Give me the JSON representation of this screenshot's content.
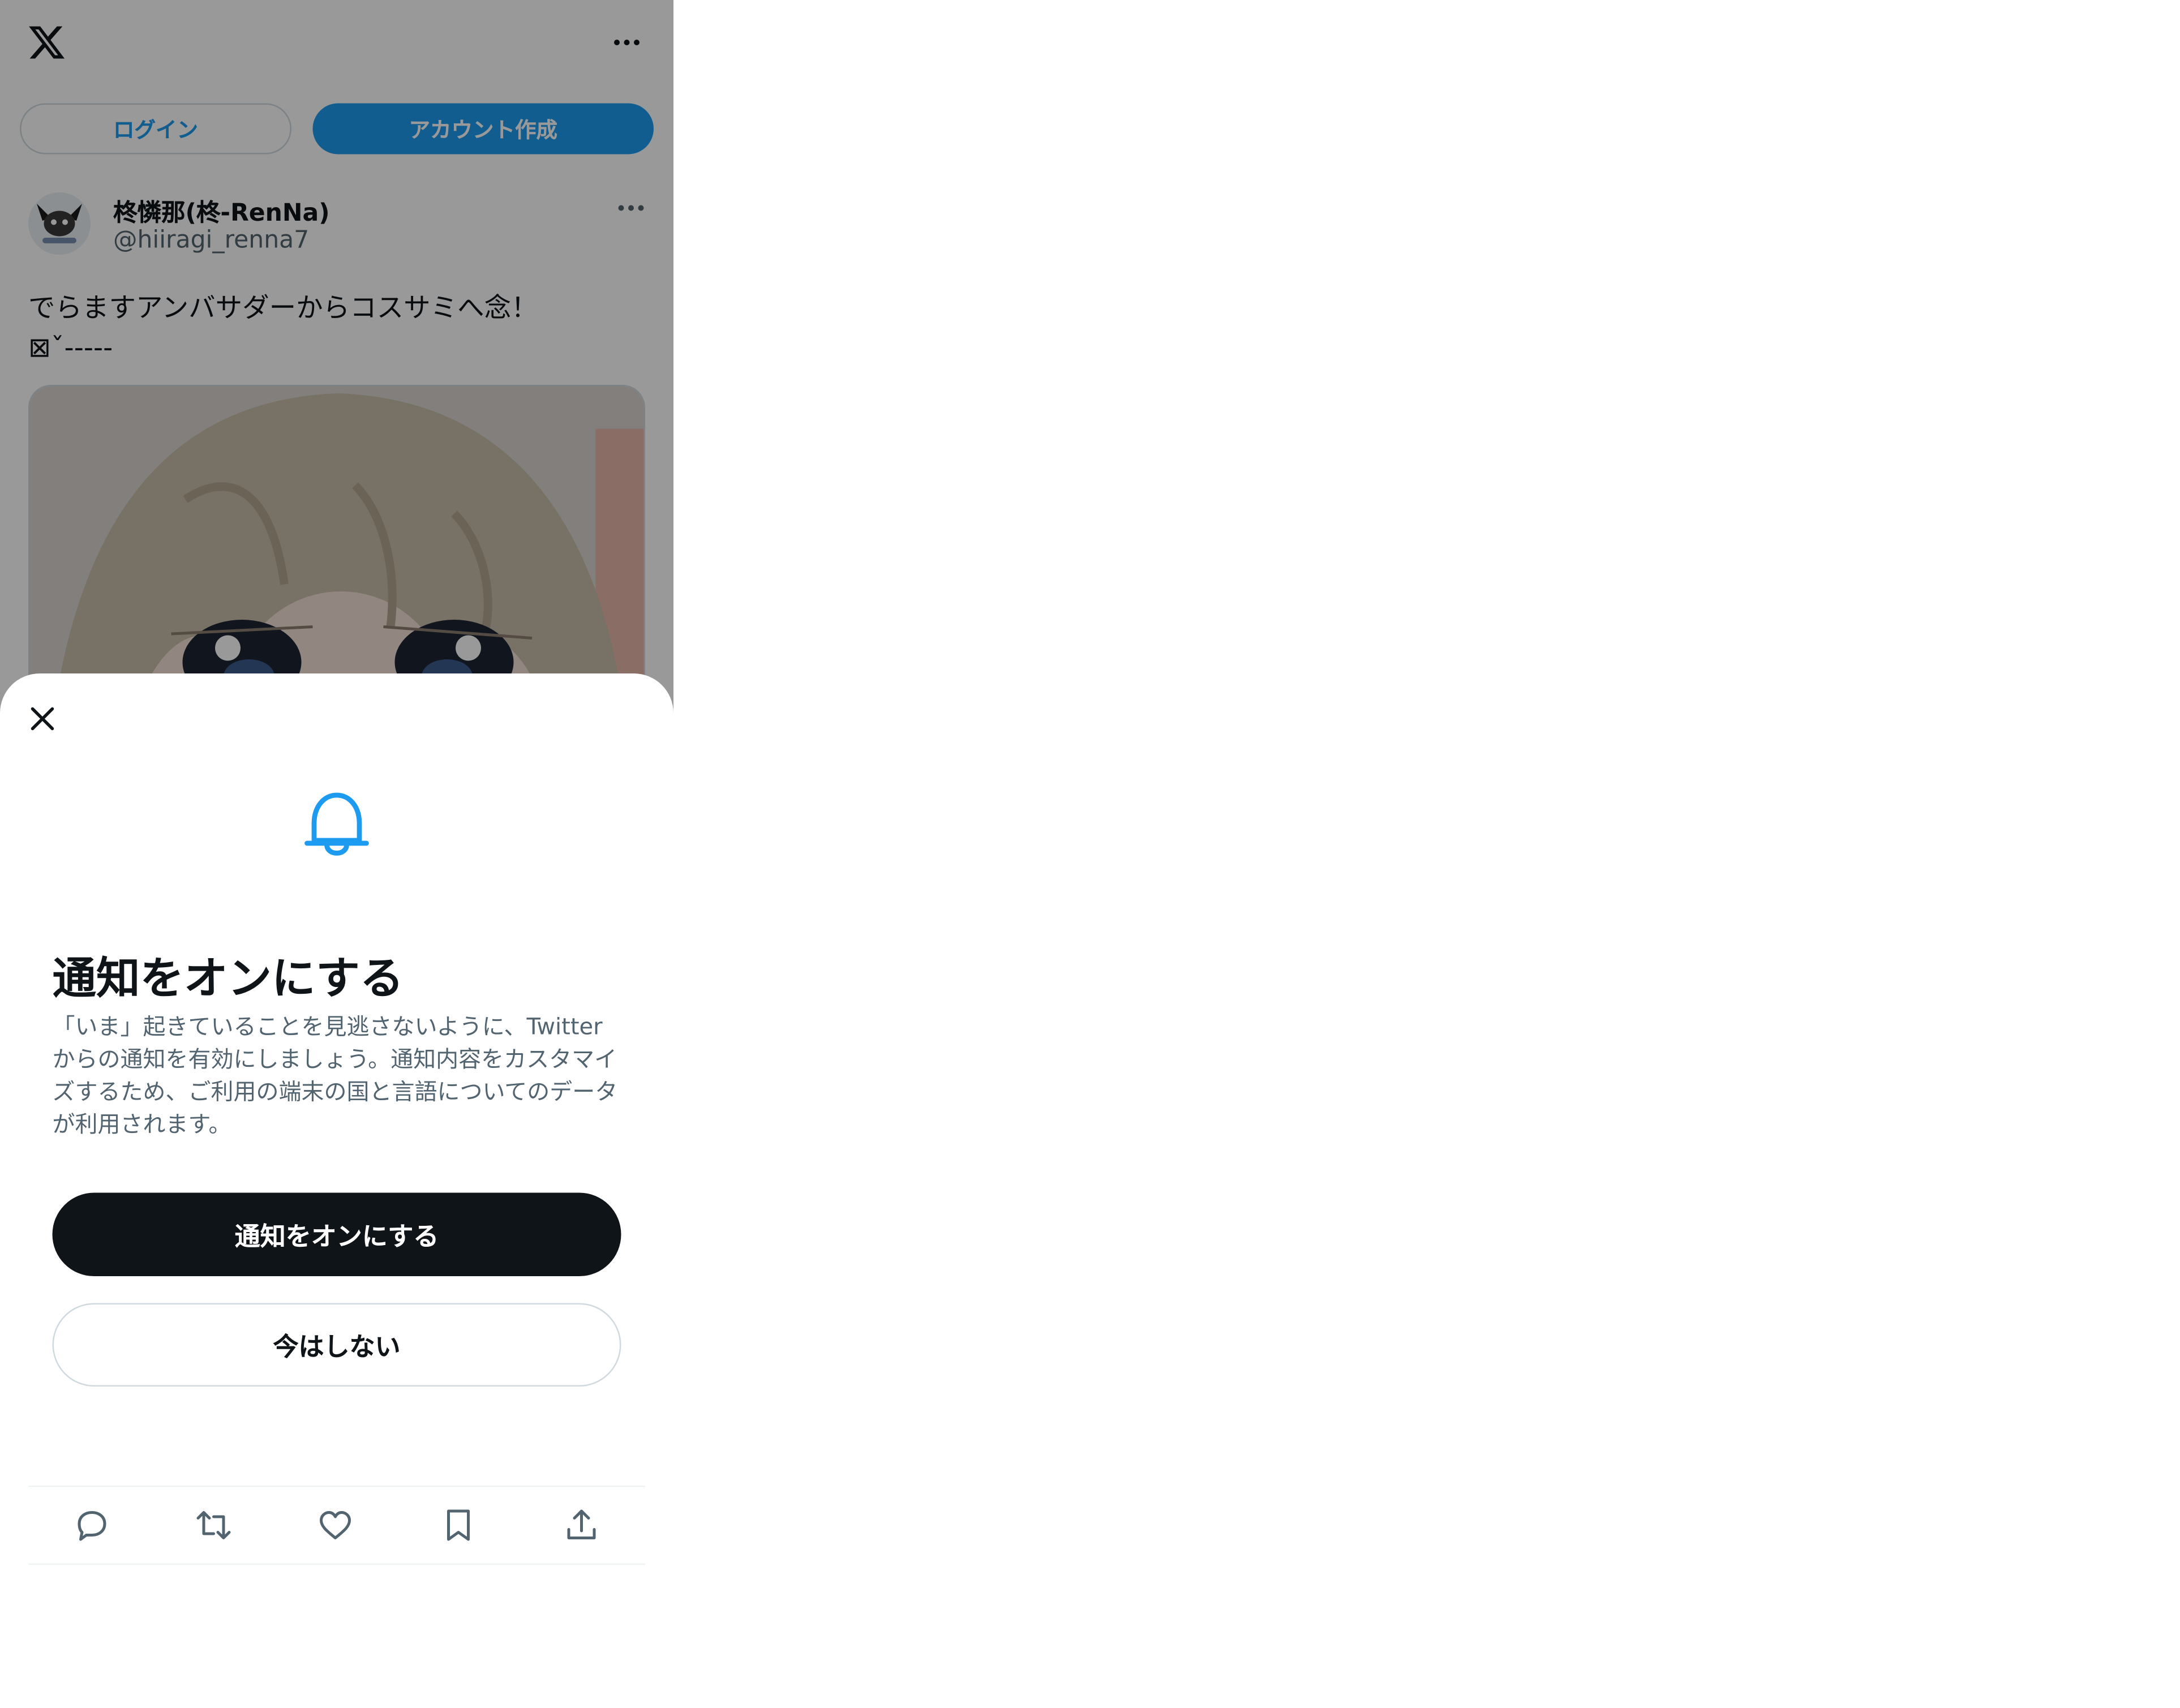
{
  "header": {
    "logo_icon": "x-logo-icon",
    "more_icon": "more-horizontal-icon",
    "login_label": "ログイン",
    "signup_label": "アカウント作成"
  },
  "post": {
    "author_name": "柊憐那(柊-RenNa)",
    "author_handle": "@hiiragi_renna7",
    "text": "でらますアンバサダーからコスサミへ念！\n⊠ˇ-----",
    "more_icon": "more-horizontal-icon"
  },
  "sheet": {
    "close_icon": "close-icon",
    "bell_icon": "bell-icon",
    "title": "通知をオンにする",
    "description": "「いま」起きていることを見逃さないように、Twitterからの通知を有効にしましょう。通知内容をカスタマイズするため、ご利用の端末の国と言語についてのデータが利用されます。",
    "primary_button": "通知をオンにする",
    "secondary_button": "今はしない"
  },
  "actions": [
    "reply-icon",
    "repost-icon",
    "like-icon",
    "bookmark-icon",
    "share-icon"
  ],
  "colors": {
    "accent": "#1d9bf0",
    "text_primary": "#0f1419",
    "text_secondary": "#536471",
    "border": "#cfd9de"
  }
}
